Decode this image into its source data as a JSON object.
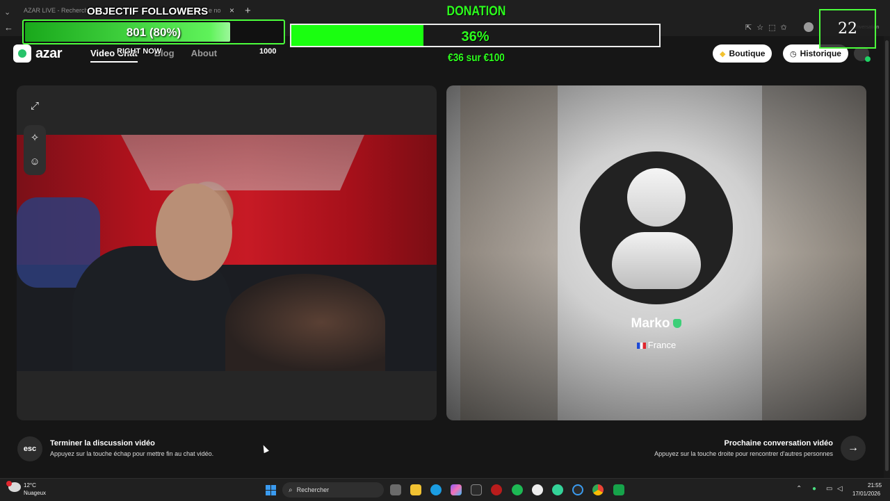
{
  "browser": {
    "tab1_title": "AZAR LIVE - Recherch",
    "tab2_title": "e no",
    "address_hint": "nversation"
  },
  "header": {
    "logo": "azar",
    "nav": [
      "Video Chat",
      "Blog",
      "About"
    ],
    "boutique_label": "Boutique",
    "historique_label": "Historique"
  },
  "peer": {
    "name": "Marko",
    "country": "France"
  },
  "controls": {
    "esc_key": "esc",
    "end_title": "Terminer la discussion vidéo",
    "end_desc": "Appuyez sur la touche échap pour mettre fin au chat vidéo.",
    "next_title": "Prochaine conversation vidéo",
    "next_desc": "Appuyez sur la touche droite pour rencontrer d'autres personnes",
    "next_arrow": "→"
  },
  "overlay": {
    "followers_title": "OBJECTIF FOLLOWERS",
    "followers_value": "801 (80%)",
    "followers_progress": 0.8,
    "right_now": "RIGHT NOW",
    "goal": "1000",
    "donation_title": "DONATION",
    "donation_percent": "36%",
    "donation_progress": 0.36,
    "donation_sub": "€36 sur €100",
    "counter": "22"
  },
  "taskbar": {
    "weather_temp": "12°C",
    "weather_desc": "Nuageux",
    "search_label": "Rechercher",
    "time": "21:55",
    "date": "17/01/2026"
  },
  "colors": {
    "overlay_green": "#2dff1e",
    "verified_green": "#3dcf78",
    "accent_blue": "#3a9bf0"
  }
}
